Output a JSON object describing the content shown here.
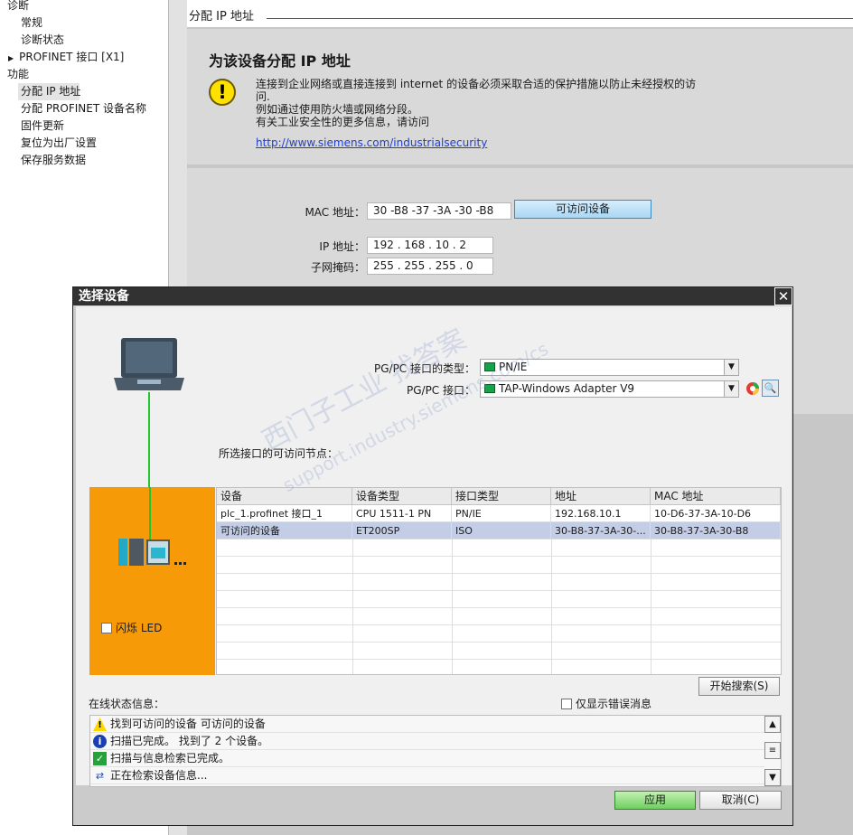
{
  "tree": {
    "items": [
      {
        "label": "诊断",
        "level": 0
      },
      {
        "label": "常规",
        "level": 1
      },
      {
        "label": "诊断状态",
        "level": 1
      },
      {
        "label": "PROFINET 接口 [X1]",
        "level": 1,
        "expander": "▶"
      },
      {
        "label": "功能",
        "level": 0
      },
      {
        "label": "分配 IP 地址",
        "level": 1,
        "selected": true
      },
      {
        "label": "分配 PROFINET 设备名称",
        "level": 1
      },
      {
        "label": "固件更新",
        "level": 1
      },
      {
        "label": "复位为出厂设置",
        "level": 1
      },
      {
        "label": "保存服务数据",
        "level": 1
      }
    ]
  },
  "right": {
    "section_title": "分配 IP 地址",
    "panel_title": "为该设备分配 IP 地址",
    "warning_icon": "!",
    "warning_line1": "连接到企业网络或直接连接到 internet 的设备必须采取合适的保护措施以防止未经授权的访",
    "warning_line1b": "问.",
    "warning_line2": "例如通过使用防火墙或网络分段。",
    "warning_line3": "有关工业安全性的更多信息，请访问",
    "link": "http://www.siemens.com/industrialsecurity",
    "mac_label": "MAC 地址：",
    "mac_value": "30 -B8 -37 -3A -30 -B8",
    "accessible_button": "可访问设备",
    "ip_label": "IP 地址：",
    "ip_value": "192 . 168 . 10   . 2",
    "subnet_label": "子网掩码：",
    "subnet_value": "255 . 255 . 255 . 0"
  },
  "dialog": {
    "title": "选择设备",
    "close": "✕",
    "pgpc_type_label": "PG/PC 接口的类型：",
    "pgpc_type_value": "PN/IE",
    "pgpc_iface_label": "PG/PC 接口：",
    "pgpc_iface_value": "TAP-Windows Adapter V9",
    "nodes_label": "所选接口的可访问节点：",
    "flash_led": "闪烁 LED",
    "columns": [
      "设备",
      "设备类型",
      "接口类型",
      "地址",
      "MAC 地址"
    ],
    "rows": [
      [
        "plc_1.profinet 接口_1",
        "CPU 1511-1 PN",
        "PN/IE",
        "192.168.10.1",
        "10-D6-37-3A-10-D6"
      ],
      [
        "可访问的设备",
        "ET200SP",
        "ISO",
        "30-B8-37-3A-30-...",
        "30-B8-37-3A-30-B8"
      ]
    ],
    "start_search": "开始搜索(S)",
    "online_status_label": "在线状态信息：",
    "only_errors": "仅显示错误消息",
    "status": [
      {
        "icon": "warning-icon",
        "text": "找到可访问的设备 可访问的设备"
      },
      {
        "icon": "info-icon",
        "text": "扫描已完成。 找到了 2 个设备。"
      },
      {
        "icon": "check-icon",
        "text": "扫描与信息检索已完成。"
      },
      {
        "icon": "network-icon",
        "text": "正在检索设备信息..."
      }
    ],
    "apply": "应用",
    "cancel": "取消(C)"
  },
  "watermark": {
    "line1": "西门子工业 找答案",
    "line2": "support.industry.siemens.com/cs"
  }
}
